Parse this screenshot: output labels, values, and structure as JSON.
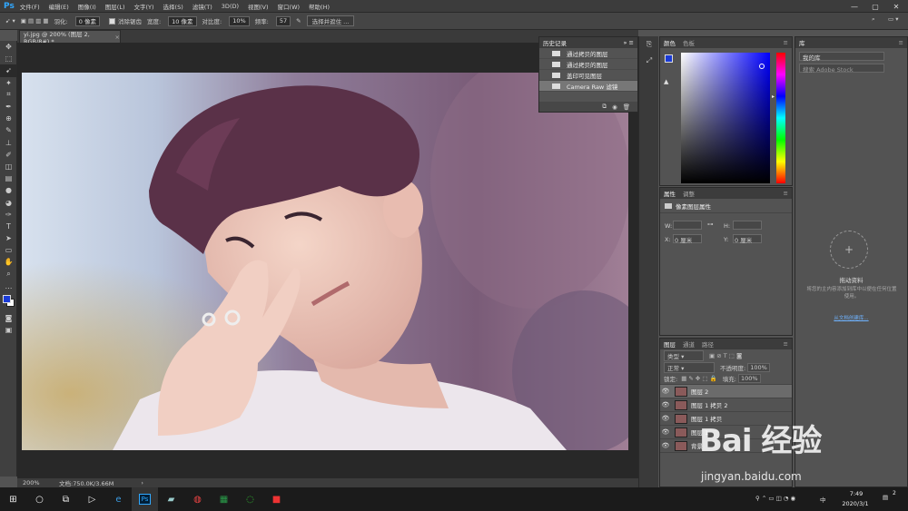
{
  "app": {
    "logo": "Ps",
    "accent": "#31a8ff"
  },
  "menu": [
    "文件(F)",
    "编辑(E)",
    "图像(I)",
    "图层(L)",
    "文字(Y)",
    "选择(S)",
    "滤镜(T)",
    "3D(D)",
    "视图(V)",
    "窗口(W)",
    "帮助(H)"
  ],
  "window_controls": {
    "minimize": "—",
    "maximize": "▢",
    "close": "✕"
  },
  "options": {
    "feather_label": "羽化:",
    "feather_value": "0 像素",
    "antialias_label": "消除锯齿",
    "width_label": "宽度:",
    "width_value": "10 像素",
    "contrast_label": "对比度:",
    "contrast_value": "10%",
    "freq_label": "频率:",
    "freq_value": "57",
    "select_mask_button": "选择并遮住 ..."
  },
  "document": {
    "tab_title": "yi.jpg @ 200% (图层 2, RGB/8#) *",
    "zoom": "200%",
    "doc_info": "文档:750.0K/3.66M"
  },
  "history": {
    "title": "历史记录",
    "items": [
      {
        "label": "通过拷贝的图层",
        "selected": false
      },
      {
        "label": "通过拷贝的图层",
        "selected": false
      },
      {
        "label": "盖印可见图层",
        "selected": false
      },
      {
        "label": "Camera Raw 滤镜",
        "selected": true
      }
    ]
  },
  "color_panel": {
    "tabs": [
      "颜色",
      "色板"
    ],
    "fg": "#1a3bd6",
    "bg": "#ffffff",
    "hue_base": "#0000ff"
  },
  "properties_panel": {
    "tabs": [
      "属性",
      "调整"
    ],
    "title": "像素图层属性",
    "w_label": "W:",
    "h_label": "H:",
    "x_label": "X:",
    "x_value": "0 厘米",
    "y_label": "Y:",
    "y_value": "0 厘米"
  },
  "layers_panel": {
    "tabs": [
      "图层",
      "通道",
      "路径"
    ],
    "kind": "类型",
    "blend": "正常",
    "opacity_label": "不透明度:",
    "opacity_value": "100%",
    "lock_label": "锁定:",
    "fill_label": "填充:",
    "fill_value": "100%",
    "layers": [
      {
        "name": "图层 2",
        "selected": true
      },
      {
        "name": "图层 1 拷贝 2",
        "selected": false
      },
      {
        "name": "图层 1 拷贝",
        "selected": false
      },
      {
        "name": "图层 1",
        "selected": false
      },
      {
        "name": "背景",
        "selected": false
      }
    ]
  },
  "library": {
    "title": "库",
    "lib_name": "我的库",
    "search_placeholder": "搜索 Adobe Stock",
    "add_label": "拖动资料",
    "desc": "将您的主内容添加到库中以便在任何位置使用。",
    "link": "从文档创建库..."
  },
  "taskbar": {
    "time": "7:49",
    "date": "2020/3/1",
    "notify_count": "2",
    "lang": "中"
  },
  "watermark": {
    "text": "Bai 经验",
    "url": "jingyan.baidu.com"
  }
}
